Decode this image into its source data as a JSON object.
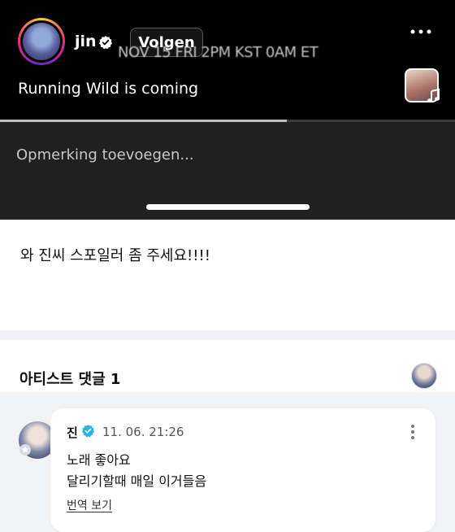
{
  "story": {
    "username": "jin",
    "follow_label": "Volgen",
    "overlay_text": "NOV 15 FRI 2PM KST 0AM ET",
    "caption": "Running Wild is coming",
    "comment_placeholder": "Opmerking toevoegen...",
    "progress_fraction": 0.63,
    "icons": {
      "verified": "verified-badge-icon",
      "more": "more-horizontal-icon",
      "music": "music-note-icon"
    }
  },
  "post": {
    "text": "와 진씨 스포일러 좀 주세요!!!!"
  },
  "artist_comments": {
    "title": "아티스트 댓글 1",
    "comment": {
      "author": "진",
      "timestamp": "11. 06. 21:26",
      "line1": "노래 좋아요",
      "line2": "달리기할때 매일 이거들음",
      "translate_label": "번역 보기"
    }
  },
  "colors": {
    "story_bg": "#000000",
    "comment_bar_bg": "#202020",
    "verified_blue": "#2bb3e6",
    "page_gray": "#f2f3f5"
  }
}
